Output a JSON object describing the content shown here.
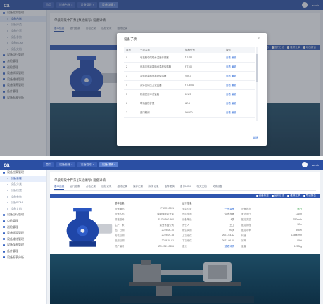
{
  "app": {
    "logo": "ca",
    "user": "admin"
  },
  "topbar": {
    "tabs": [
      "首页",
      "设备台账 ×",
      "设备管理 ×",
      "设备详情 ×"
    ]
  },
  "sidebar": {
    "items": [
      {
        "label": "设备档案管理",
        "sub": false
      },
      {
        "label": "设备台账",
        "sub": true
      },
      {
        "label": "设备分类",
        "sub": true
      },
      {
        "label": "设备位置",
        "sub": true
      },
      {
        "label": "设备参数",
        "sub": true
      },
      {
        "label": "设备BOM",
        "sub": true
      },
      {
        "label": "设备文档",
        "sub": true
      },
      {
        "label": "设备运行管理",
        "sub": false
      },
      {
        "label": "点检管理",
        "sub": false
      },
      {
        "label": "巡检管理",
        "sub": false
      },
      {
        "label": "设备润滑管理",
        "sub": false
      },
      {
        "label": "设备维修管理",
        "sub": false
      },
      {
        "label": "设备保养管理",
        "sub": false
      },
      {
        "label": "备件管理",
        "sub": false
      },
      {
        "label": "设备报表分析",
        "sub": false
      }
    ]
  },
  "page": {
    "title": "单级双吸中开泵 (泵组编号) 设备详情",
    "tabs": [
      "基本信息",
      "运行参数",
      "点检记录",
      "巡检记录",
      "维修记录",
      "保养记录",
      "润滑记录",
      "备件更换",
      "备件BOM",
      "相关文档",
      "关联设备"
    ]
  },
  "actions": [
    "设备状态",
    "运行日志",
    "维修工单",
    "导出报告"
  ],
  "modal": {
    "title": "设备子项",
    "close": "×",
    "headers": [
      "序号",
      "子项名称",
      "规格型号",
      "操作"
    ],
    "rows": [
      {
        "no": "1",
        "name": "电机驱动端轴承温度传感器",
        "spec": "PT100",
        "op": "查看  编辑"
      },
      {
        "no": "2",
        "name": "电机非驱动端轴承温度传感器",
        "spec": "PT100",
        "op": "查看  编辑"
      },
      {
        "no": "3",
        "name": "泵驱动端轴承振动传感器",
        "spec": "VIB-3",
        "op": "查看  编辑"
      },
      {
        "no": "4",
        "name": "泵体出口压力变送器",
        "spec": "PT-3051",
        "op": "查看  编辑"
      },
      {
        "no": "5",
        "name": "机械密封冲洗管路",
        "spec": "DN25",
        "op": "查看  编辑"
      },
      {
        "no": "6",
        "name": "联轴器防护罩",
        "spec": "LZ-6",
        "op": "查看  编辑"
      },
      {
        "no": "7",
        "name": "进口蝶阀",
        "spec": "DN300",
        "op": "查看  编辑"
      }
    ],
    "ok": "关闭"
  },
  "info": {
    "left_title": "基本信息",
    "left": [
      {
        "k": "设备编码",
        "v": "PUMP-0001"
      },
      {
        "k": "设备名称",
        "v": "单级双吸中开泵"
      },
      {
        "k": "规格型号",
        "v": "SLOW300-560"
      },
      {
        "k": "生产厂家",
        "v": "泵业有限公司"
      },
      {
        "k": "出厂日期",
        "v": "2019-06-10"
      },
      {
        "k": "安装日期",
        "v": "2019-09-18"
      },
      {
        "k": "投用日期",
        "v": "2019-10-01"
      },
      {
        "k": "资产编号",
        "v": "ZC-2019-0356"
      }
    ],
    "right_title": "运行信息",
    "right": [
      {
        "k": "安装位置",
        "v": "一号泵房",
        "k2": "设备状态",
        "v2": "运行"
      },
      {
        "k": "所属车间",
        "v": "供水车间",
        "k2": "累计运行",
        "v2": "1260h"
      },
      {
        "k": "设备等级",
        "v": "A类",
        "k2": "额定流量",
        "v2": "790m³/h"
      },
      {
        "k": "责任人",
        "v": "王工",
        "k2": "额定扬程",
        "v2": "32m"
      },
      {
        "k": "维保周期",
        "v": "90天",
        "k2": "额定功率",
        "v2": "90kW"
      },
      {
        "k": "上次维保",
        "v": "2021-03-12",
        "k2": "转速",
        "v2": "1480r/min"
      },
      {
        "k": "下次维保",
        "v": "2021-06-10",
        "k2": "效率",
        "v2": "85%"
      },
      {
        "k": "备注",
        "v": "查看详情",
        "k2": "重量",
        "v2": "1250kg"
      }
    ]
  },
  "colors": {
    "brand": "#2b4fa3",
    "accent": "#2f6bd6",
    "pump": "#1f46a8"
  }
}
